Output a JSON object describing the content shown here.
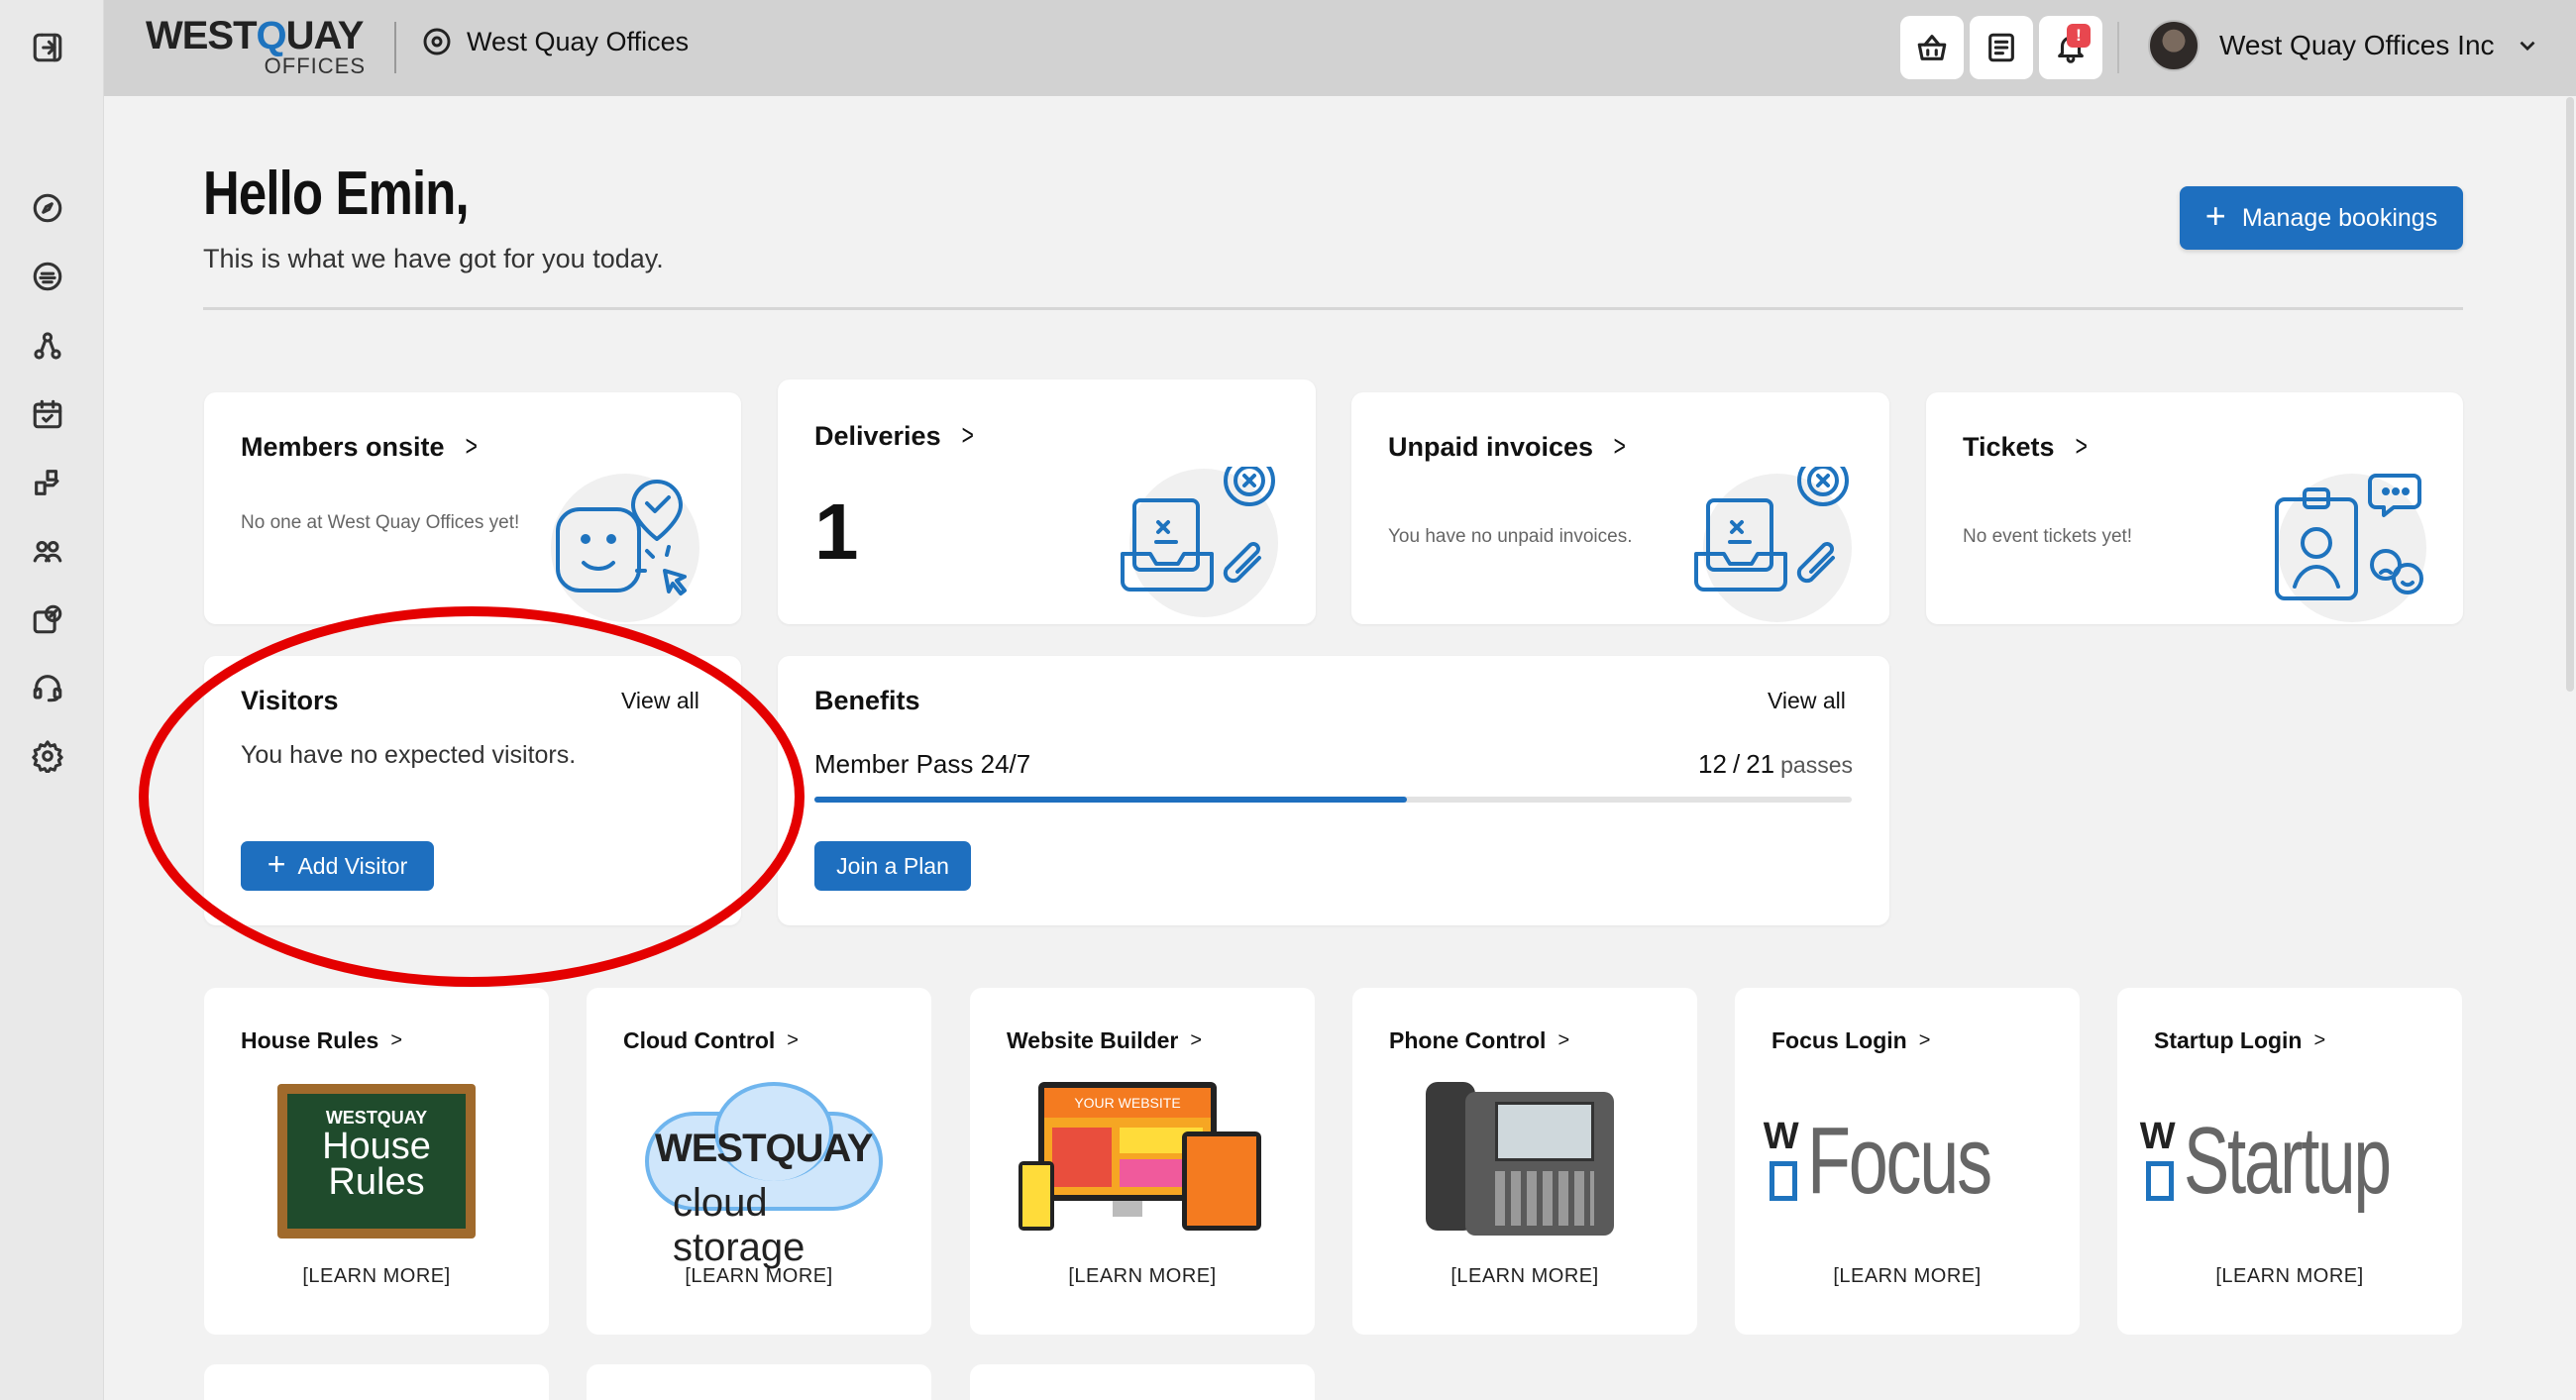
{
  "brand": {
    "logo_top": "WESTQUAY",
    "logo_sub": "OFFICES"
  },
  "topbar": {
    "location": "West Quay Offices",
    "notification_badge": "!",
    "account_name": "West Quay Offices Inc"
  },
  "greeting": {
    "title": "Hello Emin,",
    "subtitle": "This is what we have got for you today."
  },
  "actions": {
    "manage_bookings": "Manage bookings"
  },
  "cards": {
    "members": {
      "title": "Members onsite",
      "note": "No one at West Quay Offices yet!"
    },
    "deliveries": {
      "title": "Deliveries",
      "count": "1"
    },
    "invoices": {
      "title": "Unpaid invoices",
      "note": "You have no unpaid invoices."
    },
    "tickets": {
      "title": "Tickets",
      "note": "No event tickets yet!"
    },
    "visitors": {
      "title": "Visitors",
      "view_all": "View all",
      "note": "You have no expected visitors.",
      "button": "Add Visitor"
    },
    "benefits": {
      "title": "Benefits",
      "view_all": "View all",
      "plan": "Member Pass 24/7",
      "used": "12",
      "sep": "/",
      "total": "21",
      "unit": "passes",
      "progress": 0.571,
      "button": "Join a Plan"
    }
  },
  "tiles": [
    {
      "title": "House Rules",
      "learn": "[LEARN MORE]",
      "img_line1": "WESTQUAY",
      "img_line2": "House",
      "img_line3": "Rules"
    },
    {
      "title": "Cloud Control",
      "learn": "[LEARN MORE]",
      "img_line1": "WESTQUAY",
      "img_line2": "cloud storage"
    },
    {
      "title": "Website Builder",
      "learn": "[LEARN MORE]",
      "img_line1": "YOUR WEBSITE"
    },
    {
      "title": "Phone Control",
      "learn": "[LEARN MORE]"
    },
    {
      "title": "Focus Login",
      "learn": "[LEARN MORE]",
      "img_line1": "Focus"
    },
    {
      "title": "Startup Login",
      "learn": "[LEARN MORE]",
      "img_line1": "Startup"
    }
  ],
  "colors": {
    "accent": "#1e6fbf",
    "annotation": "#e40000",
    "badge": "#e8474f"
  }
}
